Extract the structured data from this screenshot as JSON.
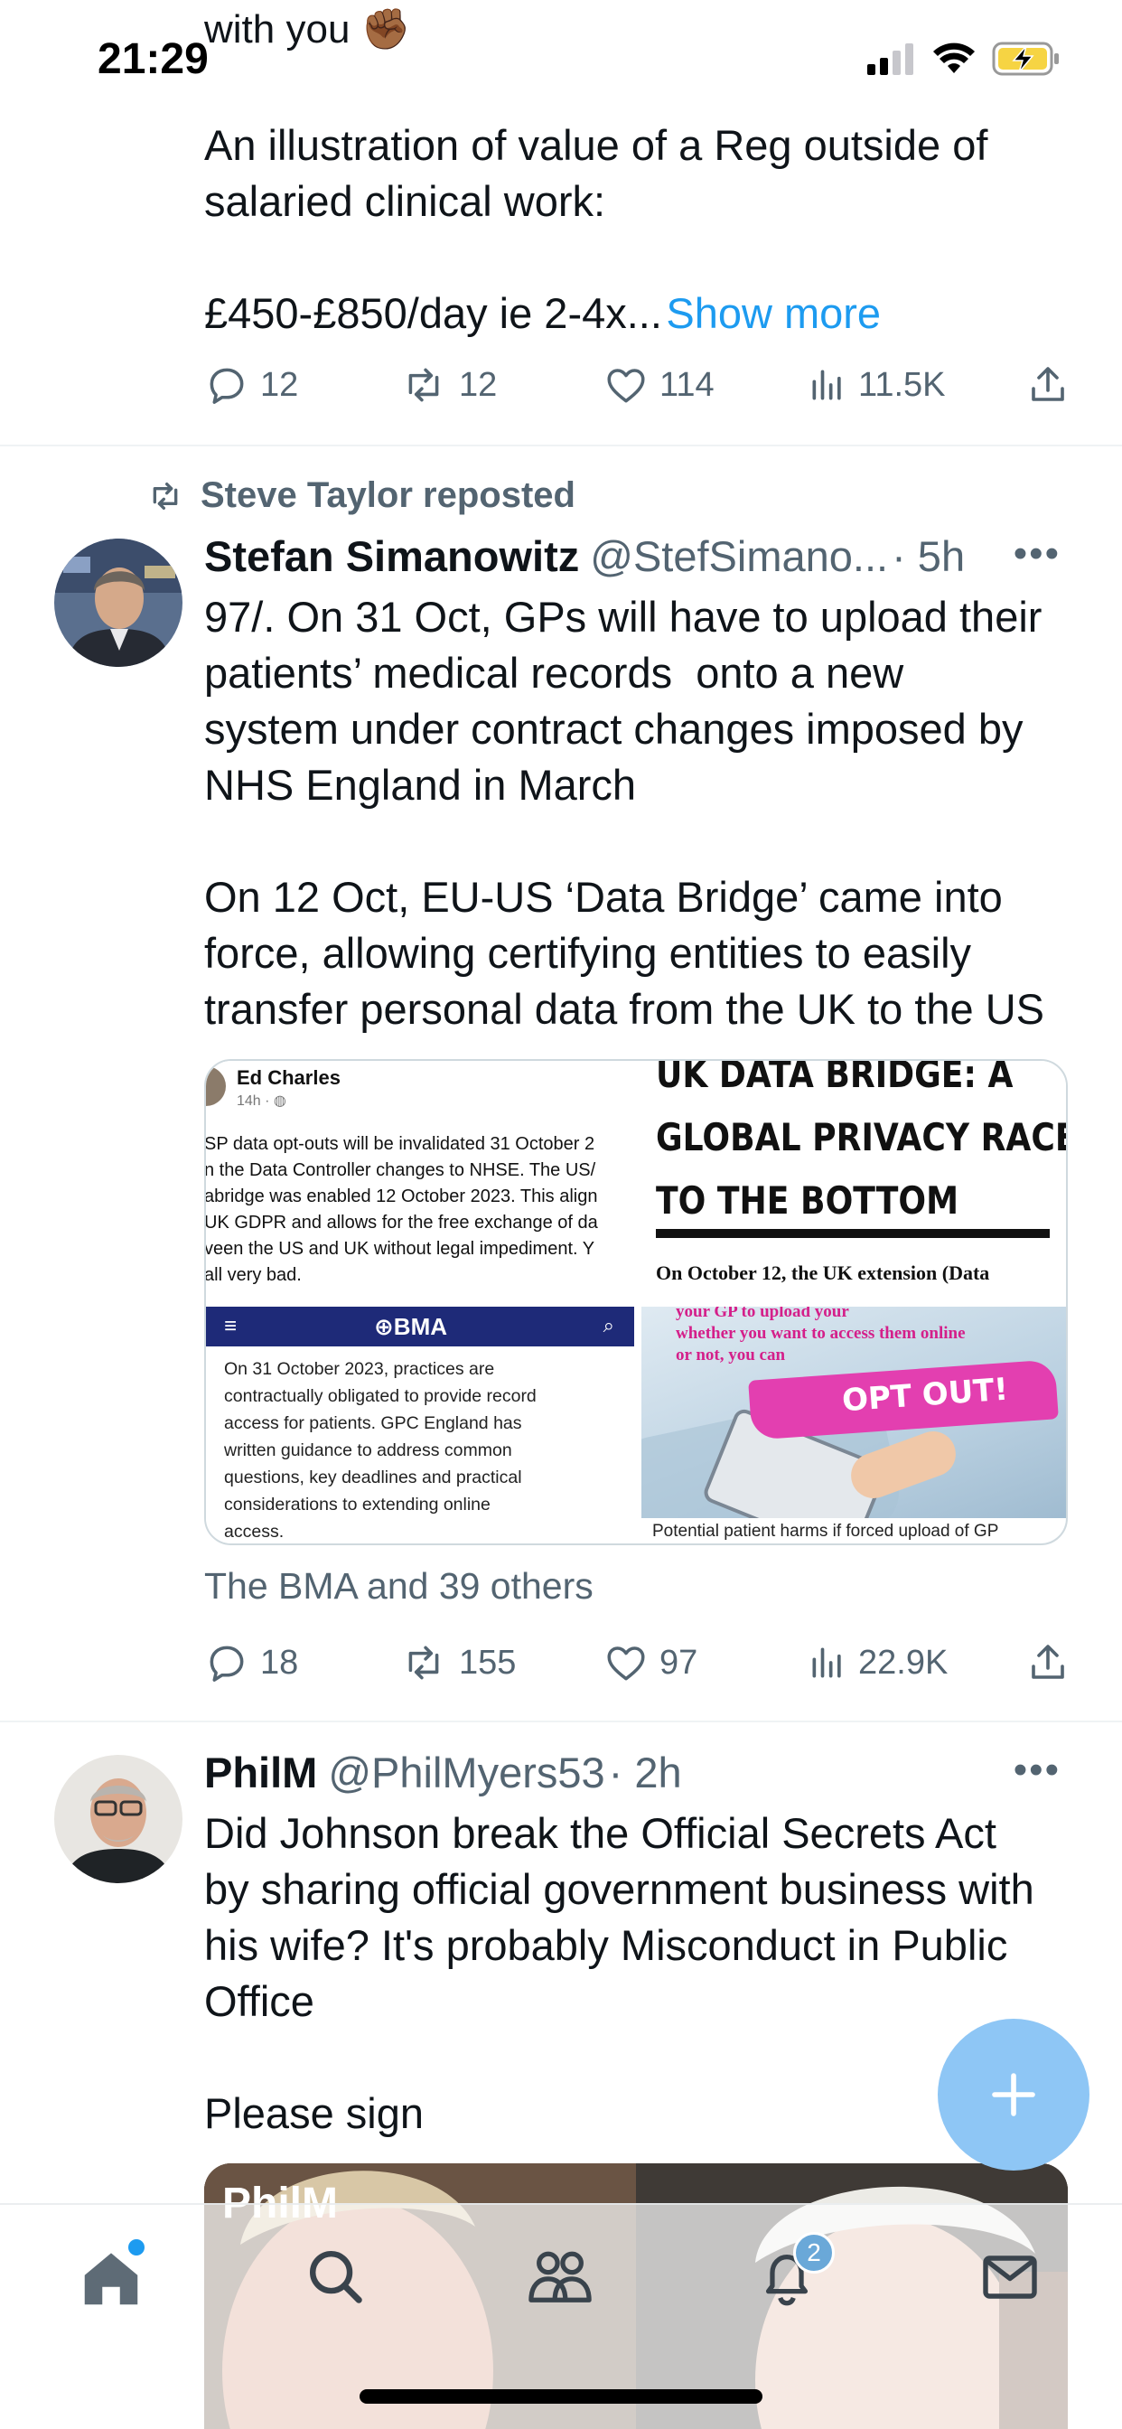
{
  "status_bar": {
    "time": "21:29"
  },
  "feed": {
    "top_partial": {
      "overflow_text": "with you ✊🏾",
      "text": "An illustration of value of a Reg outside of\nsalaried clinical work:\n\n£450-£850/day ie 2-4x...",
      "show_more": "Show more",
      "actions": {
        "replies": "12",
        "reposts": "12",
        "likes": "114",
        "views": "11.5K"
      }
    },
    "tweet1": {
      "repost_label": "Steve Taylor reposted",
      "name": "Stefan Simanowitz",
      "handle": "@StefSimano...",
      "time": "· 5h",
      "text": "97/. On 31 Oct, GPs will have to upload their\npatients’ medical records  onto a new\nsystem under contract changes imposed by\nNHS England in March\n\nOn 12 Oct, EU-US ‘Data Bridge’ came into\nforce, allowing certifying entities to easily\ntransfer personal data from the UK to the US",
      "media": {
        "fb_post": {
          "author": "Ed Charles",
          "meta": "14h ·",
          "lines": [
            "SP data opt-outs will be invalidated 31 October 2",
            "n the Data Controller changes to NHSE. The US/",
            "abridge was enabled 12 October 2023. This align",
            "UK GDPR and allows for the free exchange of da",
            "veen the US and UK without legal impediment. Y",
            "all very bad."
          ]
        },
        "article": {
          "headline_lines": [
            "UK DATA BRIDGE: A",
            "GLOBAL PRIVACY RACE",
            "TO THE BOTTOM"
          ],
          "subline": "On October 12, the UK extension (Data"
        },
        "bma": {
          "logo": "BMA",
          "text": "On 31 October 2023, practices are\ncontractually obligated to provide record\naccess for patients. GPC England has\nwritten guidance to address common\nquestions, key deadlines and practical\nconsiderations to extending online\naccess."
        },
        "optout": {
          "top_text_1": "your GP to upload your",
          "top_text_2": "whether you want to access them online",
          "top_text_3": "or not, you can",
          "banner": "OPT OUT!",
          "caption": "Potential patient harms if forced upload of GP"
        }
      },
      "tagged": "The BMA and 39 others",
      "actions": {
        "replies": "18",
        "reposts": "155",
        "likes": "97",
        "views": "22.9K"
      }
    },
    "tweet2": {
      "name": "PhilM",
      "handle": "@PhilMyers53",
      "time": "· 2h",
      "text": "Did Johnson break the Official Secrets Act\nby sharing official government business with\nhis wife? It's probably Misconduct in Public\nOffice\n\nPlease sign"
    }
  },
  "bottom_nav": {
    "notifications_badge": "2",
    "items": [
      "home-icon",
      "search-icon",
      "communities-icon",
      "notifications-icon",
      "messages-icon"
    ]
  },
  "colors": {
    "accent": "#1d9bf0",
    "fab": "#8ec6f5",
    "muted": "#536471"
  }
}
